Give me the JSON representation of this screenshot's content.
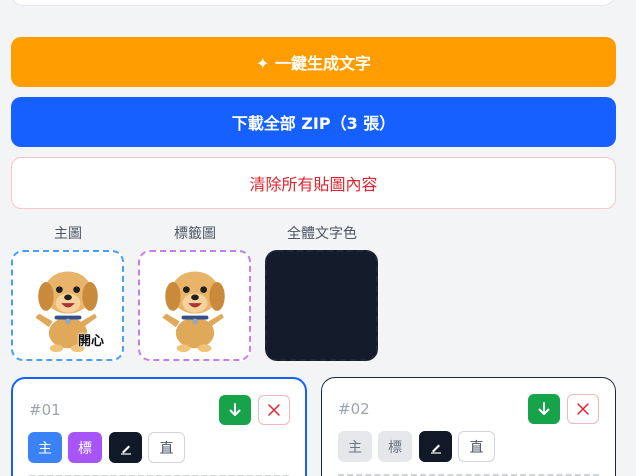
{
  "actions": {
    "generate_label": "✦ 一鍵生成文字",
    "download_label": "下載全部 ZIP（3 張）",
    "clear_label": "清除所有貼圖內容"
  },
  "thumbnails": [
    {
      "label": "主圖",
      "caption": "開心"
    },
    {
      "label": "標籤圖"
    },
    {
      "label": "全體文字色",
      "color": "#141b2b"
    }
  ],
  "cards": [
    {
      "number": "#01",
      "chip_main": "主",
      "chip_tag": "標",
      "chip_vertical": "直",
      "main_active": true,
      "tag_active": true
    },
    {
      "number": "#02",
      "chip_main": "主",
      "chip_tag": "標",
      "chip_vertical": "直",
      "main_active": false,
      "tag_active": false
    }
  ],
  "colors": {
    "orange": "#ff9d00",
    "blue": "#1660ff",
    "red": "#e0242f",
    "green": "#16a34a",
    "purple": "#a855f7"
  }
}
